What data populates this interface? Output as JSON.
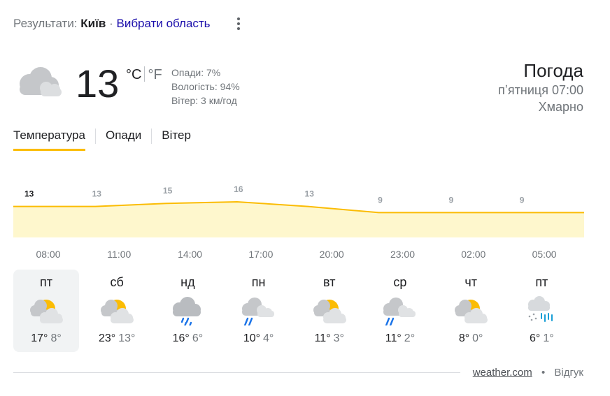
{
  "header": {
    "results_label": "Результати:",
    "city": "Київ",
    "separator": "·",
    "choose_region": "Вибрати область"
  },
  "current": {
    "temperature": "13",
    "unit_c": "°C",
    "unit_f": "°F",
    "condition_icon": "cloudy-icon",
    "precipitation": "Опади: 7%",
    "humidity": "Вологість: 94%",
    "wind": "Вітер: 3 км/год"
  },
  "summary": {
    "title": "Погода",
    "datetime": "пʼятниця 07:00",
    "condition": "Хмарно"
  },
  "tabs": [
    {
      "label": "Температура",
      "active": true
    },
    {
      "label": "Опади",
      "active": false
    },
    {
      "label": "Вітер",
      "active": false
    }
  ],
  "colors": {
    "accent": "#fbbc04",
    "area_fill": "#fef7cd",
    "link": "#1a0dab"
  },
  "chart_data": {
    "type": "area",
    "x": [
      "08:00",
      "11:00",
      "14:00",
      "17:00",
      "20:00",
      "23:00",
      "02:00",
      "05:00"
    ],
    "values": [
      13,
      13,
      15,
      16,
      13,
      9,
      9,
      9
    ],
    "line_color": "#fbbc04",
    "fill_color": "#fef7cd"
  },
  "days": [
    {
      "name": "пт",
      "high": "17°",
      "low": "8°",
      "icon": "partly-cloudy-icon",
      "selected": true
    },
    {
      "name": "сб",
      "high": "23°",
      "low": "13°",
      "icon": "partly-cloudy-icon",
      "selected": false
    },
    {
      "name": "нд",
      "high": "16°",
      "low": "6°",
      "icon": "rain-icon",
      "selected": false
    },
    {
      "name": "пн",
      "high": "10°",
      "low": "4°",
      "icon": "showers-icon",
      "selected": false
    },
    {
      "name": "вт",
      "high": "11°",
      "low": "3°",
      "icon": "partly-cloudy-icon",
      "selected": false
    },
    {
      "name": "ср",
      "high": "11°",
      "low": "2°",
      "icon": "showers-icon",
      "selected": false
    },
    {
      "name": "чт",
      "high": "8°",
      "low": "0°",
      "icon": "partly-cloudy-icon",
      "selected": false
    },
    {
      "name": "пт",
      "high": "6°",
      "low": "1°",
      "icon": "snow-rain-icon",
      "selected": false
    }
  ],
  "footer": {
    "source": "weather.com",
    "bullet": "•",
    "feedback": "Відгук"
  }
}
